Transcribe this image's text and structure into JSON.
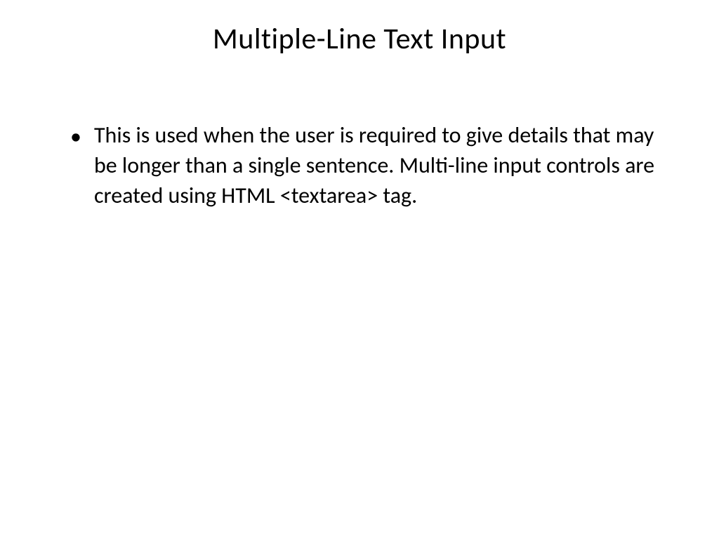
{
  "slide": {
    "title": "Multiple-Line Text Input",
    "bullets": [
      {
        "text": "This is used when the user is required to give details that may be longer than a single sentence. Multi-line input controls are created using HTML <textarea> tag."
      }
    ]
  }
}
